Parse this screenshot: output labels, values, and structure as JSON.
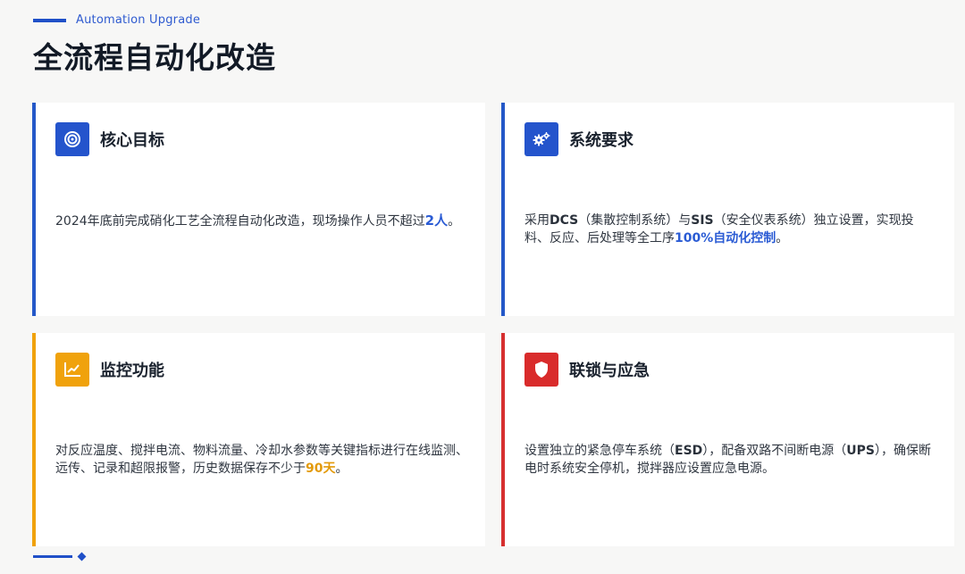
{
  "header": {
    "eyebrow": "Automation Upgrade",
    "title": "全流程自动化改造"
  },
  "cards": [
    {
      "title": "核心目标",
      "icon": "target-icon",
      "text_before": "2024年底前完成硝化工艺全流程自动化改造，现场操作人员不超过",
      "highlight": "2人",
      "text_after": "。"
    },
    {
      "title": "系统要求",
      "icon": "gears-icon",
      "t1": "采用",
      "b1": "DCS",
      "t2": "（集散控制系统）与",
      "b2": "SIS",
      "t3": "（安全仪表系统）独立设置，实现投料、反应、后处理等全工序",
      "highlight": "100%自动化控制",
      "text_after": "。"
    },
    {
      "title": "监控功能",
      "icon": "chart-line-icon",
      "text_before": "对反应温度、搅拌电流、物料流量、冷却水参数等关键指标进行在线监测、远传、记录和超限报警，历史数据保存不少于",
      "highlight": "90天",
      "text_after": "。"
    },
    {
      "title": "联锁与应急",
      "icon": "shield-icon",
      "t1": "设置独立的紧急停车系统（",
      "b1": "ESD",
      "t2": "），配备双路不间断电源（",
      "b2": "UPS",
      "t3": "），确保断电时系统安全停机，搅拌器应设置应急电源。"
    }
  ],
  "colors": {
    "accent_blue": "#2454cc",
    "accent_orange": "#f0a20c",
    "accent_red": "#d92b2b"
  }
}
